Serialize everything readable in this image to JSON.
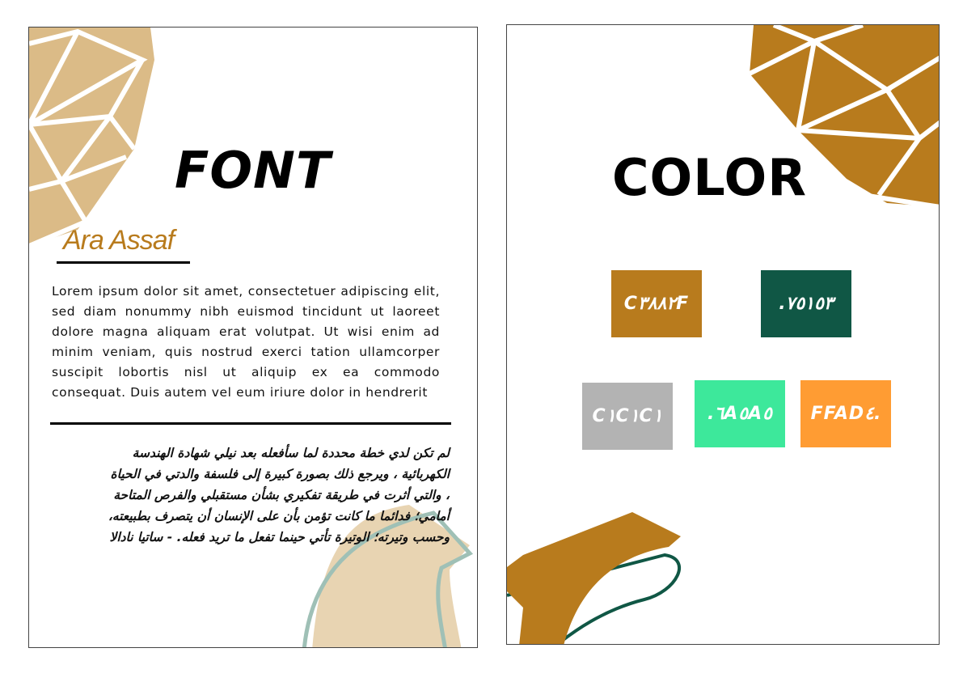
{
  "font_page": {
    "title": "FONT",
    "author": "Ara Assaf",
    "lorem": "Lorem ipsum dolor sit amet, consectetuer adipiscing elit, sed diam nonummy nibh euismod tincidunt ut laoreet dolore magna aliquam erat volutpat. Ut wisi enim ad minim veniam, quis nostrud exerci tation ullamcorper suscipit lobortis nisl ut aliquip ex ea commodo consequat. Duis autem vel eum iriure dolor in hendrerit",
    "arabic_lines": [
      "لم تكن لدي خطة محددة لما سأفعله بعد نيلي شهادة الهندسة",
      "الكهربائية ، ويرجع ذلك بصورة كبيرة إلى فلسفة والدتي في الحياة",
      "، والتي أثرت في طريقة تفكيري بشأن مستقبلي والفرص المتاحة",
      "أمامي؛ فدائما ما كانت تؤمن بأن على الإنسان أن يتصرف بطبيعته،",
      "وحسب وتيرته؛ الوتيرة تأتي حينما تفعل ما تريد فعله. - ساتيا نادالا"
    ]
  },
  "color_page": {
    "title": "COLOR",
    "swatches": [
      {
        "label": "C٣٨٨٢F",
        "color": "#b87b1d"
      },
      {
        "label": ".٧٥١٥٣",
        "color": "#105745"
      },
      {
        "label": "C١C١C١",
        "color": "#b3b3b3"
      },
      {
        "label": ".٦A٥A٥",
        "color": "#3de89b"
      },
      {
        "label": "FFAD٤.",
        "color": "#ff9c33"
      }
    ]
  }
}
